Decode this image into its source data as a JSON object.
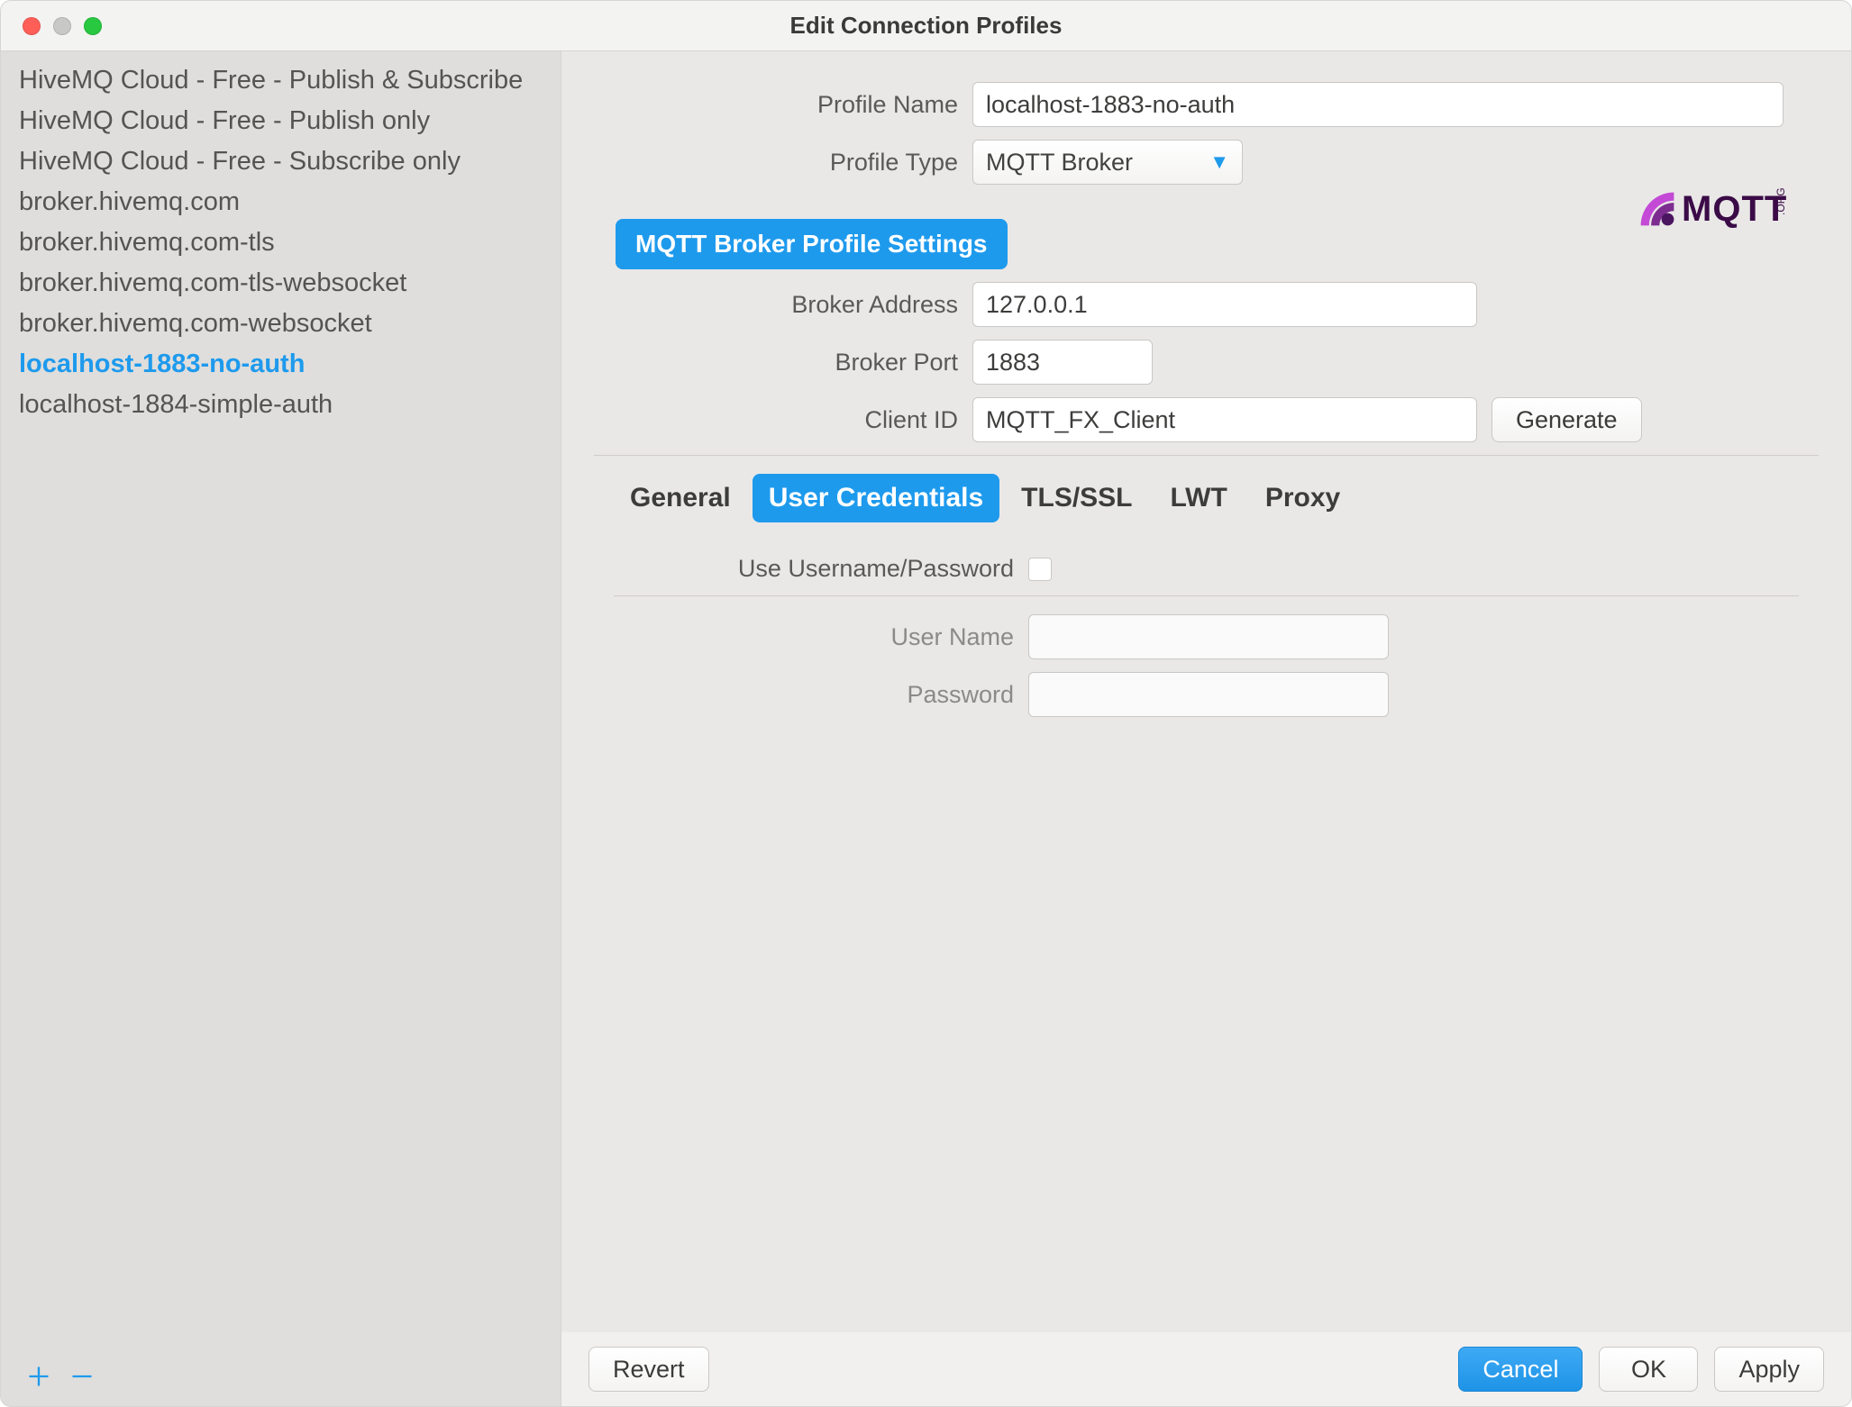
{
  "titlebar": {
    "title": "Edit Connection Profiles"
  },
  "sidebar": {
    "items": [
      {
        "label": "HiveMQ Cloud - Free - Publish & Subscribe"
      },
      {
        "label": "HiveMQ Cloud - Free - Publish only"
      },
      {
        "label": "HiveMQ Cloud - Free - Subscribe only"
      },
      {
        "label": "broker.hivemq.com"
      },
      {
        "label": "broker.hivemq.com-tls"
      },
      {
        "label": "broker.hivemq.com-tls-websocket"
      },
      {
        "label": "broker.hivemq.com-websocket"
      },
      {
        "label": "localhost-1883-no-auth"
      },
      {
        "label": "localhost-1884-simple-auth"
      }
    ],
    "selected_index": 7
  },
  "form": {
    "profile_name_label": "Profile Name",
    "profile_name_value": "localhost-1883-no-auth",
    "profile_type_label": "Profile Type",
    "profile_type_value": "MQTT Broker",
    "section_title": "MQTT Broker Profile Settings",
    "broker_address_label": "Broker Address",
    "broker_address_value": "127.0.0.1",
    "broker_port_label": "Broker Port",
    "broker_port_value": "1883",
    "client_id_label": "Client ID",
    "client_id_value": "MQTT_FX_Client",
    "generate_label": "Generate"
  },
  "tabs": {
    "items": [
      "General",
      "User Credentials",
      "TLS/SSL",
      "LWT",
      "Proxy"
    ],
    "selected_index": 1
  },
  "credentials": {
    "toggle_label": "Use Username/Password",
    "username_label": "User Name",
    "username_value": "",
    "password_label": "Password",
    "password_value": ""
  },
  "buttons": {
    "revert": "Revert",
    "cancel": "Cancel",
    "ok": "OK",
    "apply": "Apply"
  },
  "logo": {
    "text": "MQTT",
    "sub": ".ORG"
  }
}
